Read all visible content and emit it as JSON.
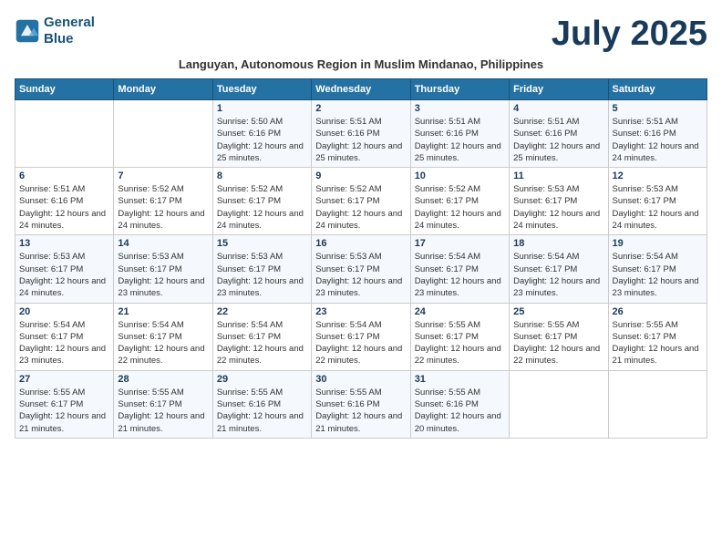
{
  "header": {
    "logo_line1": "General",
    "logo_line2": "Blue",
    "month_title": "July 2025",
    "subtitle": "Languyan, Autonomous Region in Muslim Mindanao, Philippines"
  },
  "days_of_week": [
    "Sunday",
    "Monday",
    "Tuesday",
    "Wednesday",
    "Thursday",
    "Friday",
    "Saturday"
  ],
  "weeks": [
    [
      {
        "day": "",
        "sunrise": "",
        "sunset": "",
        "daylight": ""
      },
      {
        "day": "",
        "sunrise": "",
        "sunset": "",
        "daylight": ""
      },
      {
        "day": "1",
        "sunrise": "Sunrise: 5:50 AM",
        "sunset": "Sunset: 6:16 PM",
        "daylight": "Daylight: 12 hours and 25 minutes."
      },
      {
        "day": "2",
        "sunrise": "Sunrise: 5:51 AM",
        "sunset": "Sunset: 6:16 PM",
        "daylight": "Daylight: 12 hours and 25 minutes."
      },
      {
        "day": "3",
        "sunrise": "Sunrise: 5:51 AM",
        "sunset": "Sunset: 6:16 PM",
        "daylight": "Daylight: 12 hours and 25 minutes."
      },
      {
        "day": "4",
        "sunrise": "Sunrise: 5:51 AM",
        "sunset": "Sunset: 6:16 PM",
        "daylight": "Daylight: 12 hours and 25 minutes."
      },
      {
        "day": "5",
        "sunrise": "Sunrise: 5:51 AM",
        "sunset": "Sunset: 6:16 PM",
        "daylight": "Daylight: 12 hours and 24 minutes."
      }
    ],
    [
      {
        "day": "6",
        "sunrise": "Sunrise: 5:51 AM",
        "sunset": "Sunset: 6:16 PM",
        "daylight": "Daylight: 12 hours and 24 minutes."
      },
      {
        "day": "7",
        "sunrise": "Sunrise: 5:52 AM",
        "sunset": "Sunset: 6:17 PM",
        "daylight": "Daylight: 12 hours and 24 minutes."
      },
      {
        "day": "8",
        "sunrise": "Sunrise: 5:52 AM",
        "sunset": "Sunset: 6:17 PM",
        "daylight": "Daylight: 12 hours and 24 minutes."
      },
      {
        "day": "9",
        "sunrise": "Sunrise: 5:52 AM",
        "sunset": "Sunset: 6:17 PM",
        "daylight": "Daylight: 12 hours and 24 minutes."
      },
      {
        "day": "10",
        "sunrise": "Sunrise: 5:52 AM",
        "sunset": "Sunset: 6:17 PM",
        "daylight": "Daylight: 12 hours and 24 minutes."
      },
      {
        "day": "11",
        "sunrise": "Sunrise: 5:53 AM",
        "sunset": "Sunset: 6:17 PM",
        "daylight": "Daylight: 12 hours and 24 minutes."
      },
      {
        "day": "12",
        "sunrise": "Sunrise: 5:53 AM",
        "sunset": "Sunset: 6:17 PM",
        "daylight": "Daylight: 12 hours and 24 minutes."
      }
    ],
    [
      {
        "day": "13",
        "sunrise": "Sunrise: 5:53 AM",
        "sunset": "Sunset: 6:17 PM",
        "daylight": "Daylight: 12 hours and 24 minutes."
      },
      {
        "day": "14",
        "sunrise": "Sunrise: 5:53 AM",
        "sunset": "Sunset: 6:17 PM",
        "daylight": "Daylight: 12 hours and 23 minutes."
      },
      {
        "day": "15",
        "sunrise": "Sunrise: 5:53 AM",
        "sunset": "Sunset: 6:17 PM",
        "daylight": "Daylight: 12 hours and 23 minutes."
      },
      {
        "day": "16",
        "sunrise": "Sunrise: 5:53 AM",
        "sunset": "Sunset: 6:17 PM",
        "daylight": "Daylight: 12 hours and 23 minutes."
      },
      {
        "day": "17",
        "sunrise": "Sunrise: 5:54 AM",
        "sunset": "Sunset: 6:17 PM",
        "daylight": "Daylight: 12 hours and 23 minutes."
      },
      {
        "day": "18",
        "sunrise": "Sunrise: 5:54 AM",
        "sunset": "Sunset: 6:17 PM",
        "daylight": "Daylight: 12 hours and 23 minutes."
      },
      {
        "day": "19",
        "sunrise": "Sunrise: 5:54 AM",
        "sunset": "Sunset: 6:17 PM",
        "daylight": "Daylight: 12 hours and 23 minutes."
      }
    ],
    [
      {
        "day": "20",
        "sunrise": "Sunrise: 5:54 AM",
        "sunset": "Sunset: 6:17 PM",
        "daylight": "Daylight: 12 hours and 23 minutes."
      },
      {
        "day": "21",
        "sunrise": "Sunrise: 5:54 AM",
        "sunset": "Sunset: 6:17 PM",
        "daylight": "Daylight: 12 hours and 22 minutes."
      },
      {
        "day": "22",
        "sunrise": "Sunrise: 5:54 AM",
        "sunset": "Sunset: 6:17 PM",
        "daylight": "Daylight: 12 hours and 22 minutes."
      },
      {
        "day": "23",
        "sunrise": "Sunrise: 5:54 AM",
        "sunset": "Sunset: 6:17 PM",
        "daylight": "Daylight: 12 hours and 22 minutes."
      },
      {
        "day": "24",
        "sunrise": "Sunrise: 5:55 AM",
        "sunset": "Sunset: 6:17 PM",
        "daylight": "Daylight: 12 hours and 22 minutes."
      },
      {
        "day": "25",
        "sunrise": "Sunrise: 5:55 AM",
        "sunset": "Sunset: 6:17 PM",
        "daylight": "Daylight: 12 hours and 22 minutes."
      },
      {
        "day": "26",
        "sunrise": "Sunrise: 5:55 AM",
        "sunset": "Sunset: 6:17 PM",
        "daylight": "Daylight: 12 hours and 21 minutes."
      }
    ],
    [
      {
        "day": "27",
        "sunrise": "Sunrise: 5:55 AM",
        "sunset": "Sunset: 6:17 PM",
        "daylight": "Daylight: 12 hours and 21 minutes."
      },
      {
        "day": "28",
        "sunrise": "Sunrise: 5:55 AM",
        "sunset": "Sunset: 6:17 PM",
        "daylight": "Daylight: 12 hours and 21 minutes."
      },
      {
        "day": "29",
        "sunrise": "Sunrise: 5:55 AM",
        "sunset": "Sunset: 6:16 PM",
        "daylight": "Daylight: 12 hours and 21 minutes."
      },
      {
        "day": "30",
        "sunrise": "Sunrise: 5:55 AM",
        "sunset": "Sunset: 6:16 PM",
        "daylight": "Daylight: 12 hours and 21 minutes."
      },
      {
        "day": "31",
        "sunrise": "Sunrise: 5:55 AM",
        "sunset": "Sunset: 6:16 PM",
        "daylight": "Daylight: 12 hours and 20 minutes."
      },
      {
        "day": "",
        "sunrise": "",
        "sunset": "",
        "daylight": ""
      },
      {
        "day": "",
        "sunrise": "",
        "sunset": "",
        "daylight": ""
      }
    ]
  ]
}
